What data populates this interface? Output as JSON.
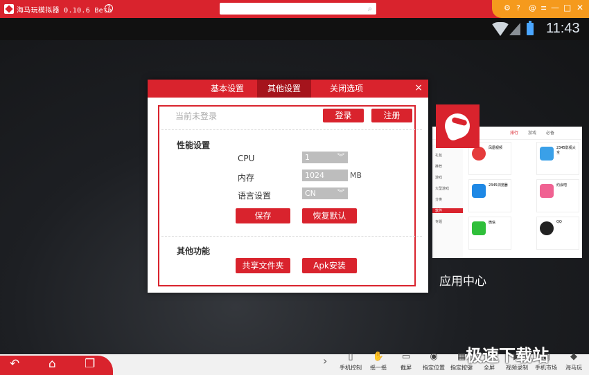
{
  "titlebar": {
    "title": "海马玩模拟器 0.10.6 Beta",
    "help_glyph": "?",
    "search_placeholder": "",
    "icons": [
      "gear-icon",
      "help-icon",
      "at-icon",
      "menu-icon"
    ],
    "icon_glyphs": [
      "⚙",
      "?",
      "@",
      "≡"
    ],
    "window_controls": [
      "—",
      "□",
      "✕"
    ]
  },
  "statusbar": {
    "time": "11:43"
  },
  "dialog": {
    "tabs": [
      {
        "label": "基本设置",
        "active": false
      },
      {
        "label": "其他设置",
        "active": true
      },
      {
        "label": "关闭选项",
        "active": false
      }
    ],
    "close_glyph": "×",
    "login_status": "当前未登录",
    "login_button": "登录",
    "register_button": "注册",
    "performance_title": "性能设置",
    "cpu_label": "CPU",
    "cpu_value": "1",
    "memory_label": "内存",
    "memory_value": "1024",
    "memory_unit": "MB",
    "language_label": "语言设置",
    "language_value": "CN",
    "save_button": "保存",
    "restore_button": "恢复默认",
    "other_title": "其他功能",
    "share_folder_button": "共享文件夹",
    "apk_install_button": "Apk安装"
  },
  "app_center": {
    "label": "应用中心",
    "tabs": [
      "排行",
      "游戏",
      "必备"
    ],
    "sidebar": [
      "礼包",
      "推荐",
      "游戏",
      "大型游戏",
      "分类",
      "软件",
      "专题"
    ],
    "apps": [
      "凤凰视频",
      "2345影视大全",
      "2345浏览器",
      "约会吧",
      "微信",
      "QQ"
    ]
  },
  "bottombar": {
    "nav_glyphs": [
      "↶",
      "⌂",
      "❐"
    ],
    "tools": [
      {
        "label": "手机控制",
        "icon": "phone-icon",
        "glyph": "▯"
      },
      {
        "label": "摇一摇",
        "icon": "shake-icon",
        "glyph": "✋"
      },
      {
        "label": "截屏",
        "icon": "screenshot-icon",
        "glyph": "▭"
      },
      {
        "label": "指定位置",
        "icon": "location-icon",
        "glyph": "◉"
      },
      {
        "label": "指定按键",
        "icon": "keyboard-icon",
        "glyph": "▦"
      },
      {
        "label": "全屏",
        "icon": "fullscreen-icon",
        "glyph": "⛶"
      },
      {
        "label": "视频录制",
        "icon": "video-icon",
        "glyph": "▶"
      },
      {
        "label": "手机市场",
        "icon": "market-icon",
        "glyph": "▣"
      },
      {
        "label": "海马玩",
        "icon": "haima-icon",
        "glyph": "◆"
      }
    ],
    "watermark": "极速下载站"
  }
}
